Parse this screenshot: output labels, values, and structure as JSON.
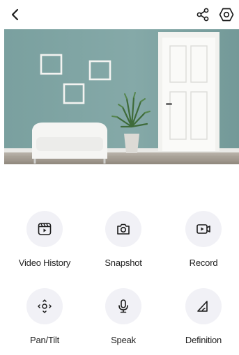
{
  "header": {
    "back_icon": "chevron-left-icon",
    "share_icon": "share-icon",
    "settings_icon": "hexagon-settings-icon"
  },
  "colors": {
    "wall": "#7fa3a2",
    "door": "#f4f4f2",
    "icon_circle": "#f1f1f6",
    "text": "#1f1f1f"
  },
  "actions": [
    {
      "label": "Video History",
      "icon": "video-history-icon"
    },
    {
      "label": "Snapshot",
      "icon": "camera-icon"
    },
    {
      "label": "Record",
      "icon": "record-video-icon"
    },
    {
      "label": "Pan/Tilt",
      "icon": "pan-tilt-icon"
    },
    {
      "label": "Speak",
      "icon": "microphone-icon"
    },
    {
      "label": "Definition",
      "icon": "definition-icon"
    }
  ]
}
